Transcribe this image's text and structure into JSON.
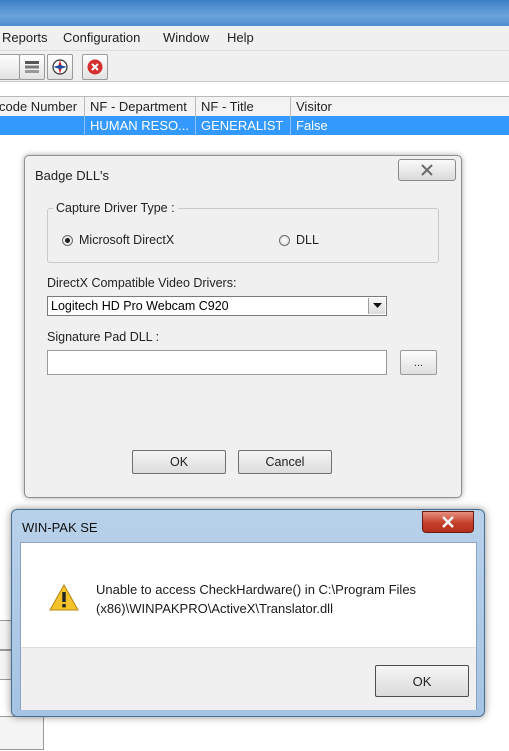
{
  "menu": {
    "items": [
      "Reports",
      "Configuration",
      "Window",
      "Help"
    ]
  },
  "toolbar": {
    "icons": [
      "layers-icon",
      "compass-icon",
      "stop-icon"
    ]
  },
  "grid": {
    "columns": [
      "code Number",
      "NF - Department",
      "NF - Title",
      "Visitor"
    ],
    "rows": [
      [
        "",
        "HUMAN RESO...",
        "GENERALIST",
        "False"
      ]
    ]
  },
  "badge_dialog": {
    "title": "Badge DLL's",
    "capture_group_label": "Capture Driver Type :",
    "radio_directx": "Microsoft DirectX",
    "radio_dll": "DLL",
    "selected": "Microsoft DirectX",
    "video_drivers_label": "DirectX Compatible Video Drivers:",
    "video_driver_value": "Logitech HD Pro Webcam C920",
    "signature_label": "Signature Pad DLL :",
    "signature_value": "",
    "browse_label": "...",
    "ok_label": "OK",
    "cancel_label": "Cancel"
  },
  "message_box": {
    "title": "WIN-PAK SE",
    "line1": "Unable to access CheckHardware() in C:\\Program Files",
    "line2": "(x86)\\WINPAKPRO\\ActiveX\\Translator.dll",
    "ok_label": "OK",
    "icon": "warning-icon"
  },
  "colors": {
    "selection": "#3399ff",
    "close_red": "#c4402b"
  }
}
